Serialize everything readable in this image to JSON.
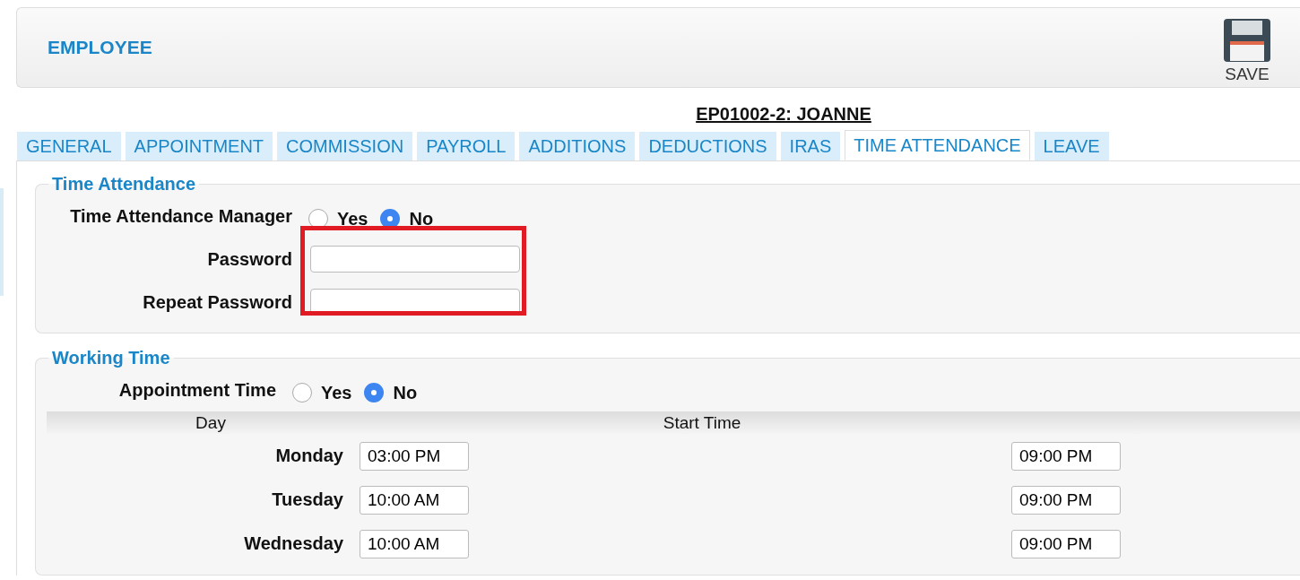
{
  "header": {
    "title": "EMPLOYEE",
    "save_label": "SAVE"
  },
  "record_title": "EP01002-2: JOANNE",
  "tabs": [
    {
      "label": "GENERAL",
      "selected": false
    },
    {
      "label": "APPOINTMENT",
      "selected": false
    },
    {
      "label": "COMMISSION",
      "selected": false
    },
    {
      "label": "PAYROLL",
      "selected": false
    },
    {
      "label": "ADDITIONS",
      "selected": false
    },
    {
      "label": "DEDUCTIONS",
      "selected": false
    },
    {
      "label": "IRAS",
      "selected": false
    },
    {
      "label": "TIME ATTENDANCE",
      "selected": true
    },
    {
      "label": "LEAVE",
      "selected": false
    }
  ],
  "time_attendance": {
    "legend": "Time Attendance",
    "manager": {
      "label": "Time Attendance Manager",
      "options": [
        {
          "label": "Yes",
          "selected": false
        },
        {
          "label": "No",
          "selected": true
        }
      ]
    },
    "password": {
      "label": "Password"
    },
    "repeat_password": {
      "label": "Repeat Password"
    }
  },
  "working_time": {
    "legend": "Working Time",
    "appointment_time": {
      "label": "Appointment Time",
      "options": [
        {
          "label": "Yes",
          "selected": false
        },
        {
          "label": "No",
          "selected": true
        }
      ]
    },
    "columns": [
      "Day",
      "Start Time"
    ],
    "rows": [
      {
        "day": "Monday",
        "start": "03:00 PM",
        "end": "09:00 PM"
      },
      {
        "day": "Tuesday",
        "start": "10:00 AM",
        "end": "09:00 PM"
      },
      {
        "day": "Wednesday",
        "start": "10:00 AM",
        "end": "09:00 PM"
      }
    ]
  }
}
